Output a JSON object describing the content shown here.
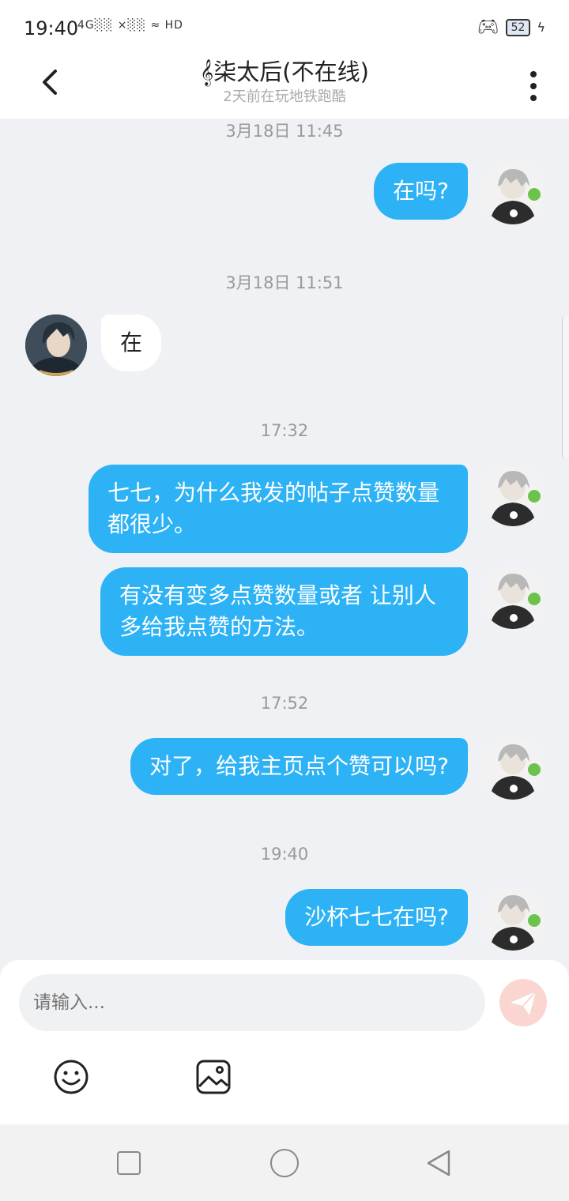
{
  "status_bar": {
    "time": "19:40",
    "indicators": "4G░░ ×░░ ≈ HD",
    "battery": "52"
  },
  "header": {
    "title": "𝄞柒太后(不在线)",
    "subtitle": "2天前在玩地铁跑酷"
  },
  "messages": [
    {
      "type": "timestamp",
      "text": "3月18日 11:45"
    },
    {
      "type": "out",
      "text": "在吗?"
    },
    {
      "type": "timestamp",
      "text": "3月18日 11:51"
    },
    {
      "type": "in",
      "text": "在"
    },
    {
      "type": "timestamp",
      "text": "17:32"
    },
    {
      "type": "out",
      "text": "七七，为什么我发的帖子点赞数量都很少。"
    },
    {
      "type": "out",
      "text": " 有没有变多点赞数量或者 让别人多给我点赞的方法。"
    },
    {
      "type": "timestamp",
      "text": "17:52"
    },
    {
      "type": "out",
      "text": "对了，给我主页点个赞可以吗?"
    },
    {
      "type": "timestamp",
      "text": "19:40"
    },
    {
      "type": "out",
      "text": "沙杯七七在吗?"
    }
  ],
  "composer": {
    "placeholder": "请输入..."
  },
  "colors": {
    "accent": "#2cb2f5",
    "background": "#eff1f4",
    "send_disabled": "#fbd6d0"
  },
  "icons": {
    "back": "chevron-left-icon",
    "more": "more-vertical-icon",
    "send": "paper-plane-icon",
    "emoji": "smiley-icon",
    "image": "image-icon"
  }
}
